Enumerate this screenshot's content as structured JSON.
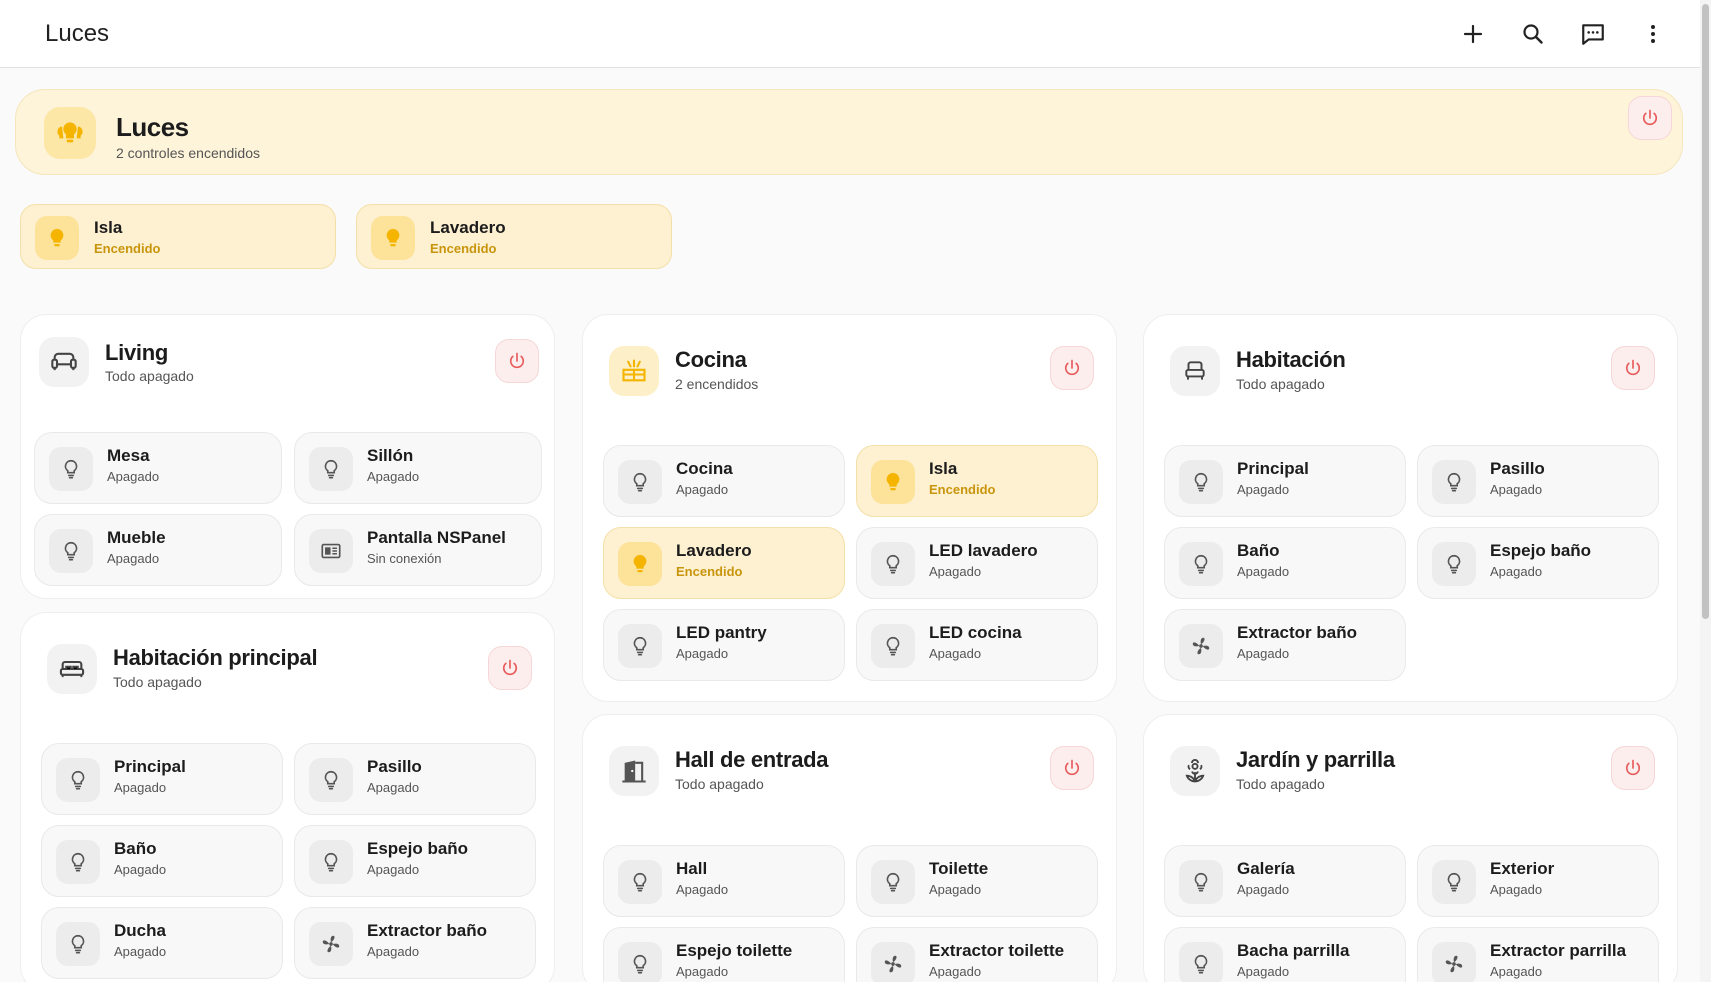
{
  "header": {
    "title": "Luces"
  },
  "hero": {
    "title": "Luces",
    "subtitle": "2 controles encendidos"
  },
  "chips": [
    {
      "name": "Isla",
      "state": "Encendido"
    },
    {
      "name": "Lavadero",
      "state": "Encendido"
    }
  ],
  "areas": {
    "living": {
      "title": "Living",
      "subtitle": "Todo apagado",
      "tiles": [
        {
          "name": "Mesa",
          "state": "Apagado"
        },
        {
          "name": "Sillón",
          "state": "Apagado"
        },
        {
          "name": "Mueble",
          "state": "Apagado"
        },
        {
          "name": "Pantalla NSPanel",
          "state": "Sin conexión"
        }
      ]
    },
    "habitacion_principal": {
      "title": "Habitación principal",
      "subtitle": "Todo apagado",
      "tiles": [
        {
          "name": "Principal",
          "state": "Apagado"
        },
        {
          "name": "Pasillo",
          "state": "Apagado"
        },
        {
          "name": "Baño",
          "state": "Apagado"
        },
        {
          "name": "Espejo baño",
          "state": "Apagado"
        },
        {
          "name": "Ducha",
          "state": "Apagado"
        },
        {
          "name": "Extractor baño",
          "state": "Apagado"
        }
      ]
    },
    "cocina": {
      "title": "Cocina",
      "subtitle": "2 encendidos",
      "tiles": [
        {
          "name": "Cocina",
          "state": "Apagado"
        },
        {
          "name": "Isla",
          "state": "Encendido"
        },
        {
          "name": "Lavadero",
          "state": "Encendido"
        },
        {
          "name": "LED lavadero",
          "state": "Apagado"
        },
        {
          "name": "LED pantry",
          "state": "Apagado"
        },
        {
          "name": "LED cocina",
          "state": "Apagado"
        }
      ]
    },
    "hall": {
      "title": "Hall de entrada",
      "subtitle": "Todo apagado",
      "tiles": [
        {
          "name": "Hall",
          "state": "Apagado"
        },
        {
          "name": "Toilette",
          "state": "Apagado"
        },
        {
          "name": "Espejo toilette",
          "state": "Apagado"
        },
        {
          "name": "Extractor toilette",
          "state": "Apagado"
        }
      ]
    },
    "habitacion": {
      "title": "Habitación",
      "subtitle": "Todo apagado",
      "tiles": [
        {
          "name": "Principal",
          "state": "Apagado"
        },
        {
          "name": "Pasillo",
          "state": "Apagado"
        },
        {
          "name": "Baño",
          "state": "Apagado"
        },
        {
          "name": "Espejo baño",
          "state": "Apagado"
        },
        {
          "name": "Extractor baño",
          "state": "Apagado"
        }
      ]
    },
    "jardin": {
      "title": "Jardín y parrilla",
      "subtitle": "Todo apagado",
      "tiles": [
        {
          "name": "Galería",
          "state": "Apagado"
        },
        {
          "name": "Exterior",
          "state": "Apagado"
        },
        {
          "name": "Bacha parrilla",
          "state": "Apagado"
        },
        {
          "name": "Extractor parrilla",
          "state": "Apagado"
        }
      ]
    }
  },
  "colors": {
    "on": "#f4b400",
    "off": "#555555",
    "power": "#e85c5c",
    "hero_bg": "#fdf4d9"
  }
}
